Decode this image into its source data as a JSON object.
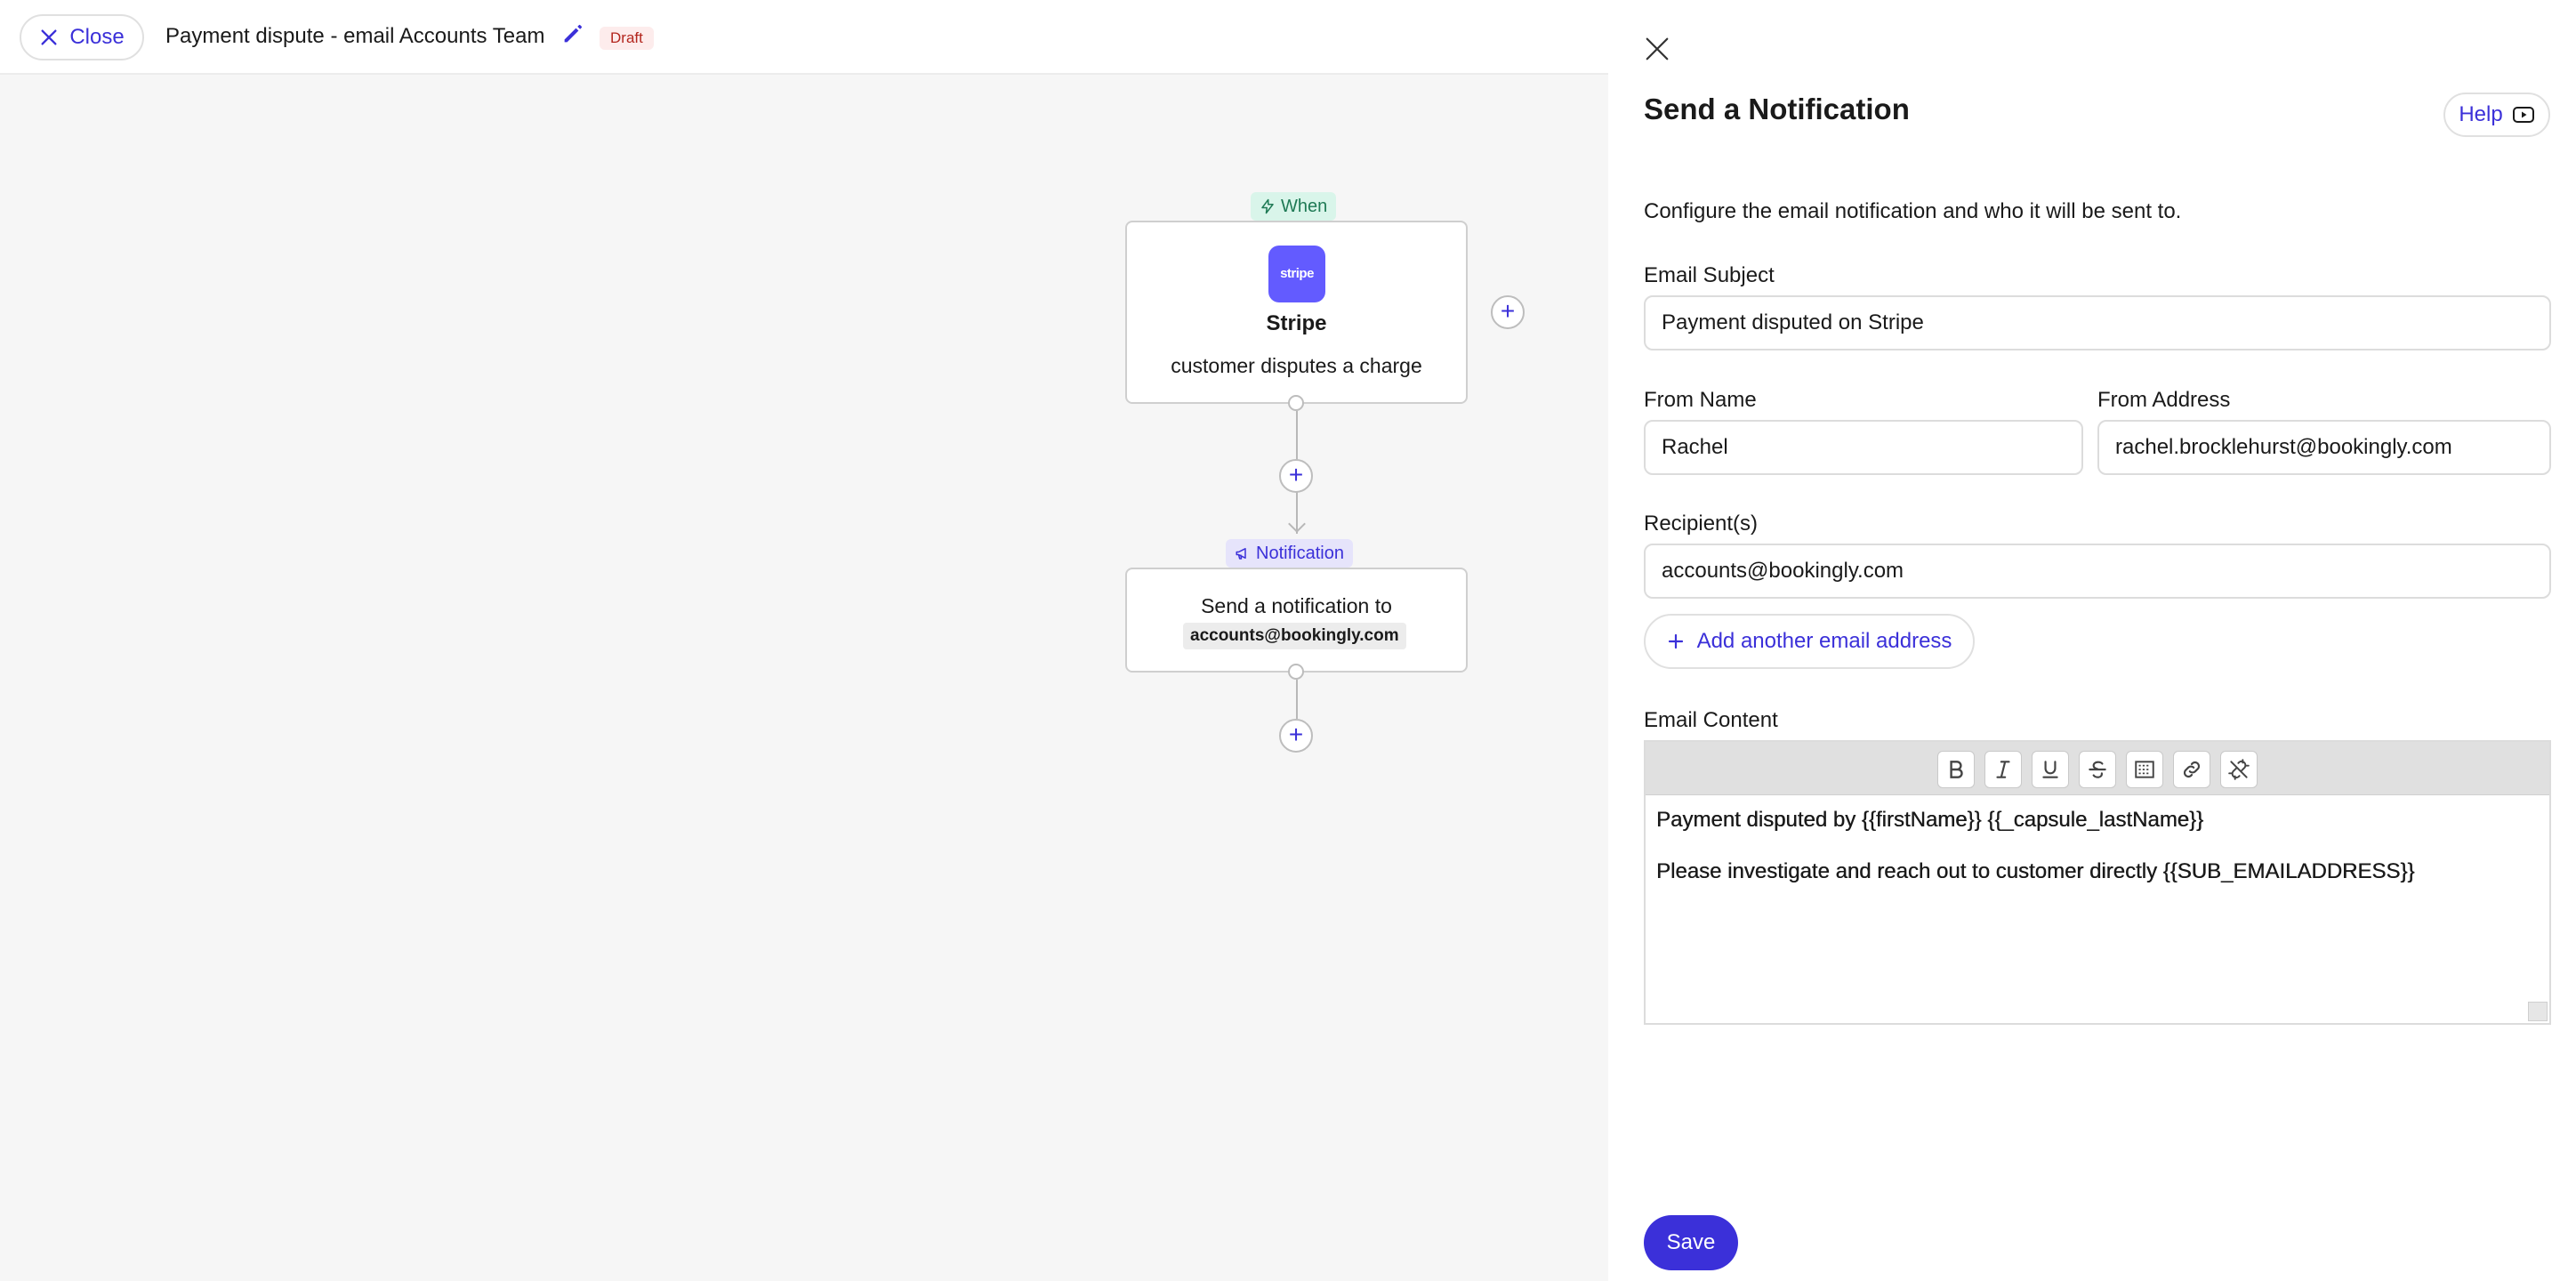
{
  "topbar": {
    "close_label": "Close",
    "title": "Payment dispute - email Accounts Team",
    "status_badge": "Draft"
  },
  "workflow": {
    "trigger_tag": "When",
    "trigger_logo_text": "stripe",
    "trigger_title": "Stripe",
    "trigger_subtitle": "customer disputes a charge",
    "action_tag": "Notification",
    "action_text": "Send a notification to",
    "action_email": "accounts@bookingly.com"
  },
  "panel": {
    "title": "Send a Notification",
    "help_label": "Help",
    "description": "Configure the email notification and who it will be sent to.",
    "email_subject": {
      "label": "Email Subject",
      "value": "Payment disputed on Stripe"
    },
    "from_name": {
      "label": "From Name",
      "value": "Rachel"
    },
    "from_address": {
      "label": "From Address",
      "value": "rachel.brocklehurst@bookingly.com"
    },
    "recipients": {
      "label": "Recipient(s)",
      "value": "accounts@bookingly.com"
    },
    "add_email_label": "Add another email address",
    "email_content": {
      "label": "Email Content",
      "line1": "Payment disputed by {{firstName}} {{_capsule_lastName}}",
      "line2": "Please investigate and reach out to customer directly {{SUB_EMAILADDRESS}}"
    },
    "save_label": "Save"
  },
  "colors": {
    "accent": "#3b30d9",
    "stripe": "#635bff",
    "when_tag_bg": "#d9f5ea",
    "draft_badge_text": "#b3261e"
  },
  "icons": [
    "close-icon",
    "pencil-icon",
    "bolt-icon",
    "megaphone-icon",
    "plus-icon",
    "youtube-icon",
    "bold-icon",
    "italic-icon",
    "underline-icon",
    "strikethrough-icon",
    "code-block-icon",
    "link-icon",
    "unlink-icon"
  ]
}
